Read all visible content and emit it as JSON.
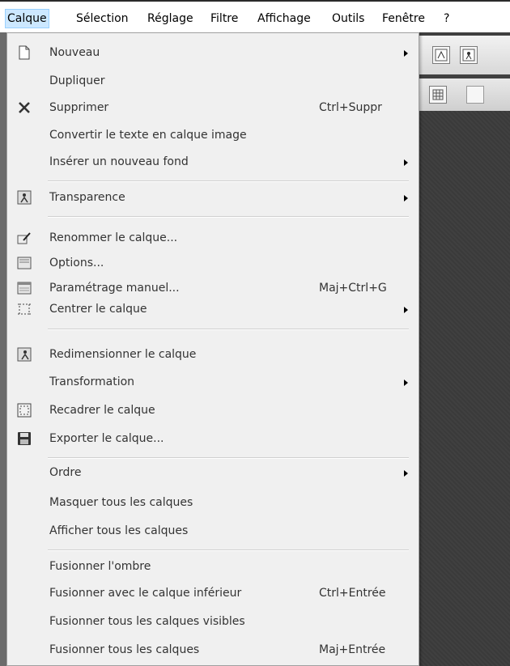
{
  "menubar": {
    "items": [
      "Calque",
      "Sélection",
      "Réglage",
      "Filtre",
      "Affichage",
      "Outils",
      "Fenêtre",
      "?"
    ]
  },
  "menu": {
    "items": [
      {
        "label": "Nouveau",
        "shortcut": "",
        "submenu": true,
        "icon": "new-document-icon"
      },
      {
        "label": "Dupliquer",
        "shortcut": "",
        "submenu": false,
        "icon": ""
      },
      {
        "label": "Supprimer",
        "shortcut": "Ctrl+Suppr",
        "submenu": false,
        "icon": "delete-x-icon"
      },
      {
        "label": "Convertir le texte en calque image",
        "shortcut": "",
        "submenu": false,
        "icon": ""
      },
      {
        "label": "Insérer un nouveau fond",
        "shortcut": "",
        "submenu": true,
        "icon": ""
      },
      {
        "label": "Transparence",
        "shortcut": "",
        "submenu": true,
        "icon": "transparency-icon"
      },
      {
        "label": "Renommer le calque...",
        "shortcut": "",
        "submenu": false,
        "icon": "rename-icon"
      },
      {
        "label": "Options...",
        "shortcut": "",
        "submenu": false,
        "icon": "options-icon"
      },
      {
        "label": "Paramétrage manuel...",
        "shortcut": "Maj+Ctrl+G",
        "submenu": false,
        "icon": "manual-settings-icon"
      },
      {
        "label": "Centrer le calque",
        "shortcut": "",
        "submenu": true,
        "icon": "center-layer-icon"
      },
      {
        "label": "Redimensionner le calque",
        "shortcut": "",
        "submenu": false,
        "icon": "resize-icon"
      },
      {
        "label": "Transformation",
        "shortcut": "",
        "submenu": true,
        "icon": ""
      },
      {
        "label": "Recadrer le calque",
        "shortcut": "",
        "submenu": false,
        "icon": "crop-icon"
      },
      {
        "label": "Exporter le calque...",
        "shortcut": "",
        "submenu": false,
        "icon": "save-disk-icon"
      },
      {
        "label": "Ordre",
        "shortcut": "",
        "submenu": true,
        "icon": ""
      },
      {
        "label": "Masquer tous les calques",
        "shortcut": "",
        "submenu": false,
        "icon": ""
      },
      {
        "label": "Afficher tous les calques",
        "shortcut": "",
        "submenu": false,
        "icon": ""
      },
      {
        "label": "Fusionner l'ombre",
        "shortcut": "",
        "submenu": false,
        "icon": ""
      },
      {
        "label": "Fusionner avec le calque inférieur",
        "shortcut": "Ctrl+Entrée",
        "submenu": false,
        "icon": ""
      },
      {
        "label": "Fusionner tous les calques visibles",
        "shortcut": "",
        "submenu": false,
        "icon": ""
      },
      {
        "label": "Fusionner tous les calques",
        "shortcut": "Maj+Entrée",
        "submenu": false,
        "icon": ""
      }
    ]
  }
}
